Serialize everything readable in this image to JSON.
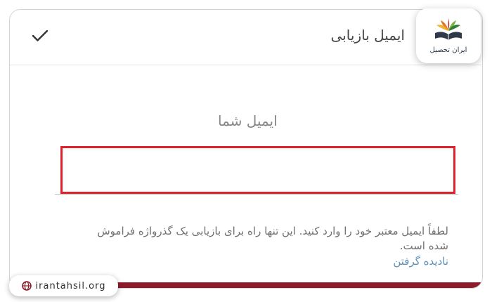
{
  "header": {
    "title": "ایمیل بازیابی",
    "confirm_icon": "check-icon"
  },
  "brand": {
    "logo_text": "ایران تحصیل",
    "logo_icon": "book-leaves-logo-icon",
    "site_url": "irantahsil.org",
    "globe_icon": "globe-icon",
    "accent_color": "#8c1d2b"
  },
  "form": {
    "label": "ایمیل شما",
    "value": "",
    "highlight_color": "#e0202a",
    "helper_text": "لطفاً ایمیل معتبر خود را وارد کنید. این تنها راه برای بازیابی یک گذرواژه فراموش شده است.",
    "skip_label": "نادیده گرفتن"
  }
}
